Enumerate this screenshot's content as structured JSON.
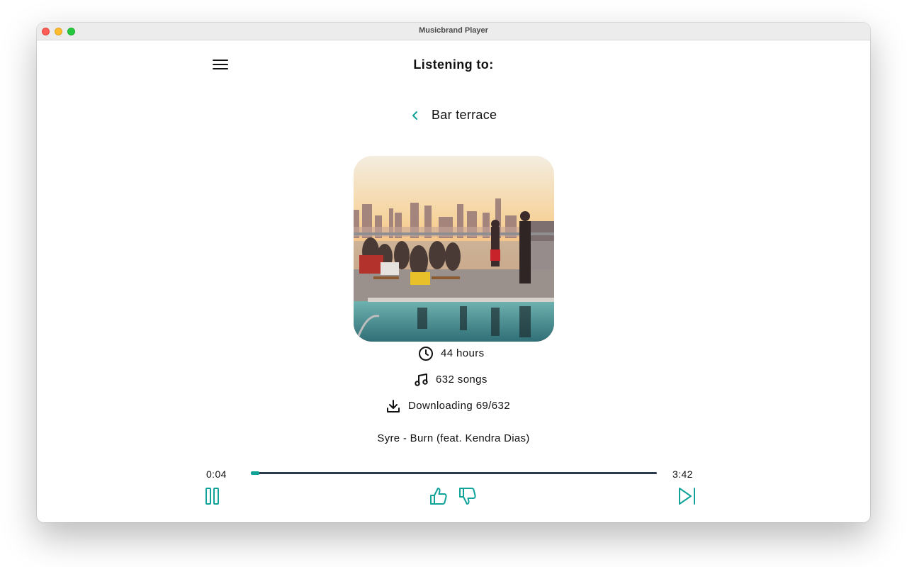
{
  "window": {
    "title": "Musicbrand Player"
  },
  "header": {
    "title": "Listening to:"
  },
  "playlist": {
    "name": "Bar terrace"
  },
  "stats": {
    "duration": "44 hours",
    "songs": "632 songs",
    "download": "Downloading 69/632"
  },
  "now_playing": {
    "track": "Syre - Burn (feat. Kendra Dias)"
  },
  "player": {
    "elapsed": "0:04",
    "total": "3:42",
    "progress_fraction": 0.018
  },
  "icons": {
    "menu": "hamburger-menu-icon",
    "back": "chevron-left-icon",
    "clock": "clock-icon",
    "music": "music-note-icon",
    "download": "download-icon",
    "pause": "pause-icon",
    "like": "thumbs-up-icon",
    "dislike": "thumbs-down-icon",
    "next": "skip-next-icon"
  },
  "colors": {
    "accent": "#0fa39a",
    "text": "#111111",
    "track": "#2b3a4a"
  }
}
